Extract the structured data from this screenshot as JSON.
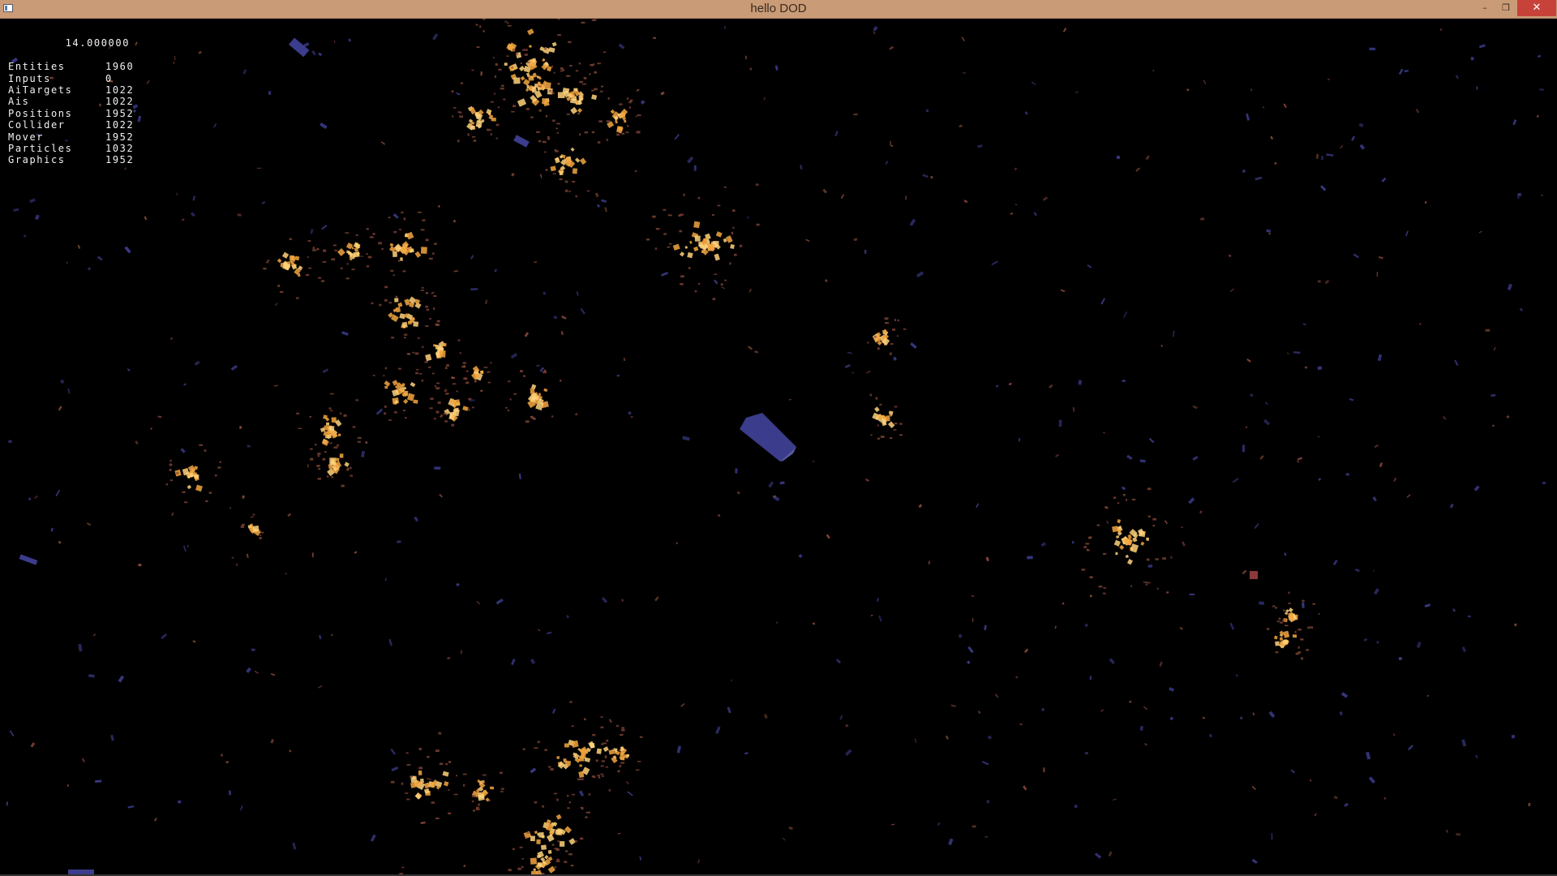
{
  "window": {
    "title": "hello DOD",
    "minimize_icon": "minimize-icon",
    "minimize_glyph": "–",
    "maximize_icon": "restore-icon",
    "maximize_glyph": "❐",
    "close_icon": "close-icon",
    "close_glyph": "✕",
    "titlebar_color": "#c99b76",
    "close_color": "#c7433a"
  },
  "hud": {
    "time": "14.000000",
    "stats": [
      {
        "label": "Entities",
        "value": "1960"
      },
      {
        "label": "Inputs",
        "value": "0"
      },
      {
        "label": "AiTargets",
        "value": "1022"
      },
      {
        "label": "Ais",
        "value": "1022"
      },
      {
        "label": "Positions",
        "value": "1952"
      },
      {
        "label": "Collider",
        "value": "1022"
      },
      {
        "label": "Mover",
        "value": "1952"
      },
      {
        "label": "Particles",
        "value": "1032"
      },
      {
        "label": "Graphics",
        "value": "1952"
      }
    ]
  },
  "scene": {
    "background": "#000000",
    "colors": {
      "explosion": "#f2a640",
      "explosion_light": "#ffd27a",
      "debris": "#8a4a3a",
      "ship": "#3c3c8c",
      "ship_light": "#5a5aa8"
    }
  }
}
